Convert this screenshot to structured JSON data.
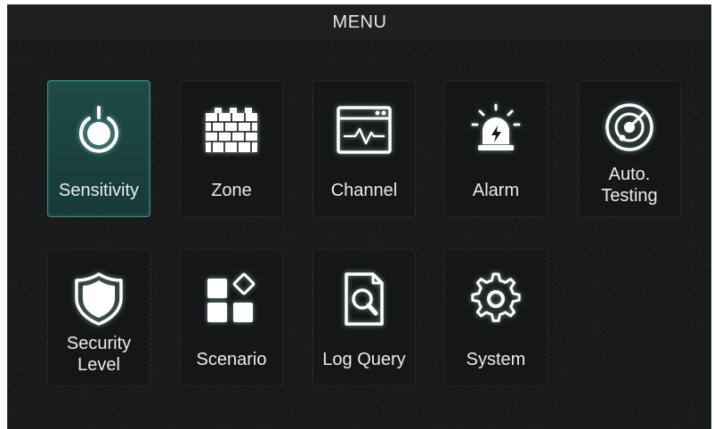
{
  "window": {
    "title": "MENU"
  },
  "menu": {
    "items": [
      {
        "id": "sensitivity",
        "label": "Sensitivity",
        "icon": "power-knob-icon",
        "selected": true
      },
      {
        "id": "zone",
        "label": "Zone",
        "icon": "brick-wall-icon",
        "selected": false
      },
      {
        "id": "channel",
        "label": "Channel",
        "icon": "signal-window-icon",
        "selected": false
      },
      {
        "id": "alarm",
        "label": "Alarm",
        "icon": "siren-icon",
        "selected": false
      },
      {
        "id": "auto-testing",
        "label_line1": "Auto.",
        "label_line2": "Testing",
        "icon": "radar-icon",
        "selected": false
      },
      {
        "id": "security-level",
        "label_line1": "Security",
        "label_line2": "Level",
        "icon": "shield-icon",
        "selected": false
      },
      {
        "id": "scenario",
        "label": "Scenario",
        "icon": "tiles-icon",
        "selected": false
      },
      {
        "id": "log-query",
        "label": "Log Query",
        "icon": "document-search-icon",
        "selected": false
      },
      {
        "id": "system",
        "label": "System",
        "icon": "gear-icon",
        "selected": false
      }
    ]
  },
  "colors": {
    "background": "#161918",
    "title_bar": "#1d201f",
    "selected_tile": "#1e4a47",
    "selected_border": "#3f8c86",
    "icon": "#ffffff",
    "text": "#eaecec"
  }
}
